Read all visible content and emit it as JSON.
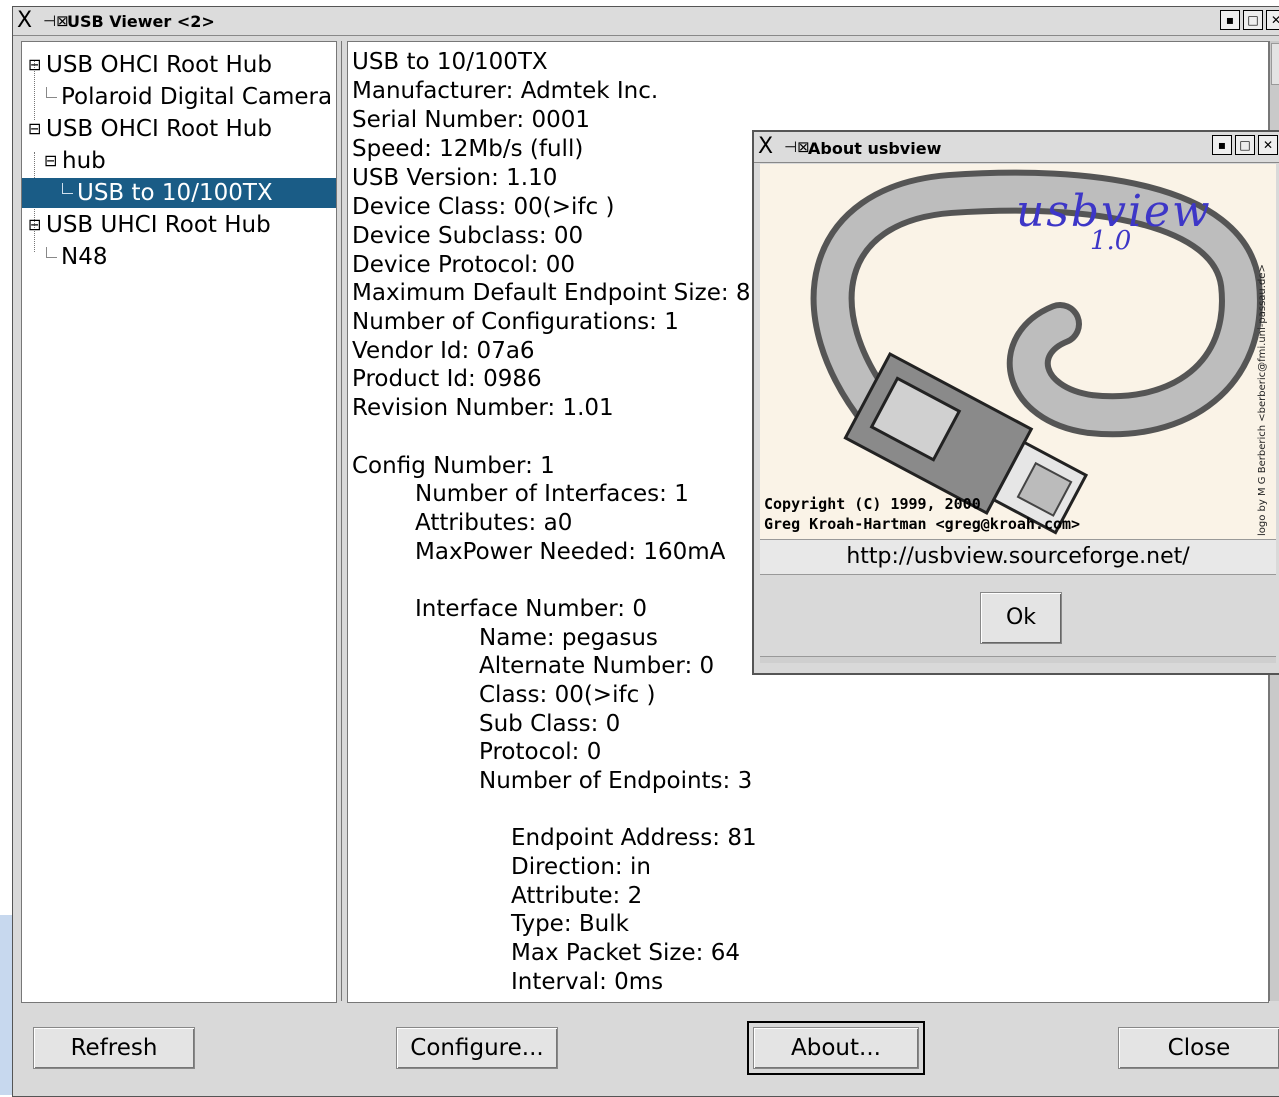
{
  "window": {
    "title": "USB Viewer <2>",
    "app_icon": "x-logo",
    "pin_icon": "pin-icon"
  },
  "tree": {
    "items": [
      {
        "label": "USB OHCI Root Hub",
        "kind": "expanded-node"
      },
      {
        "label": "Polaroid Digital Camera",
        "kind": "leaf"
      },
      {
        "label": "USB OHCI Root Hub",
        "kind": "expanded-node"
      },
      {
        "label": "hub",
        "kind": "expanded-node"
      },
      {
        "label": "USB to 10/100TX",
        "kind": "leaf",
        "selected": true
      },
      {
        "label": "USB UHCI Root Hub",
        "kind": "expanded-node"
      },
      {
        "label": "N48",
        "kind": "leaf"
      }
    ]
  },
  "details": {
    "lines": [
      "USB to 10/100TX",
      "Manufacturer: Admtek Inc.",
      "Serial Number: 0001",
      "Speed: 12Mb/s (full)",
      "USB Version:  1.10",
      "Device Class: 00(>ifc )",
      "Device Subclass: 00",
      "Device Protocol: 00",
      "Maximum Default Endpoint Size: 8",
      "Number of Configurations: 1",
      "Vendor Id: 07a6",
      "Product Id: 0986",
      "Revision Number:  1.01",
      "Config Number: 1",
      "Number of Interfaces: 1",
      "Attributes: a0",
      "MaxPower Needed: 160mA",
      "Interface Number: 0",
      "Name: pegasus",
      "Alternate Number: 0",
      "Class: 00(>ifc )",
      "Sub Class: 0",
      "Protocol: 0",
      "Number of Endpoints: 3",
      "Endpoint Address: 81",
      "Direction: in",
      "Attribute: 2",
      "Type: Bulk",
      "Max Packet Size: 64",
      "Interval: 0ms"
    ]
  },
  "buttons": {
    "refresh": "Refresh",
    "configure": "Configure...",
    "about": "About...",
    "close": "Close"
  },
  "about_dialog": {
    "title": "About usbview",
    "logo_title": "usbview",
    "logo_version": "1.0",
    "logo_credit": "logo by M G Berberich <berberic@fmi.uni-passau.de>",
    "copyright_line1": "Copyright (C) 1999, 2000",
    "copyright_line2": "Greg Kroah-Hartman <greg@kroah.com>",
    "url": "http://usbview.sourceforge.net/",
    "ok": "Ok"
  },
  "colors": {
    "selection": "#1a5c86",
    "logo_text": "#3d36c7",
    "window_bg": "#d9d9d9"
  }
}
